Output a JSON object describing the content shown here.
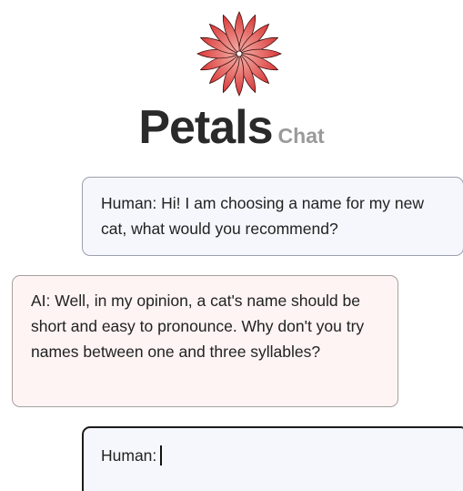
{
  "header": {
    "logo_icon": "red-flower-icon",
    "brand": "Petals",
    "subtitle": "Chat",
    "accent_color": "#e04545"
  },
  "messages": [
    {
      "role": "human",
      "text": "Human: Hi! I am choosing a name for my new cat, what would you recommend?"
    },
    {
      "role": "ai",
      "text": "AI: Well, in my opinion, a cat's name should be short and easy to pronounce. Why don't you try names between one and three syllables?"
    }
  ],
  "input": {
    "prefix": "Human:",
    "value": ""
  }
}
